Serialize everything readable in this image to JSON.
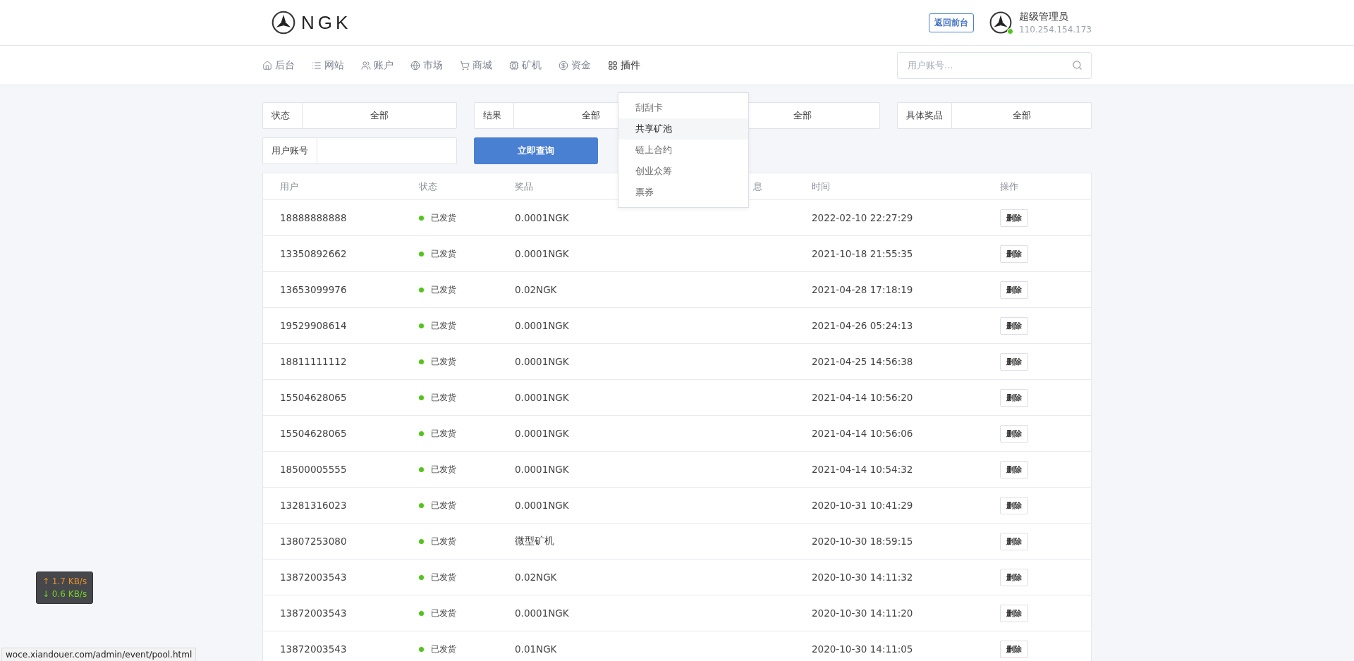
{
  "header": {
    "logo_text": "NGK",
    "back_button": "返回前台",
    "user": {
      "name": "超级管理员",
      "ip": "110.254.154.173",
      "online": true
    }
  },
  "nav": {
    "items": [
      {
        "kind": "home",
        "label": "后台",
        "selected": false
      },
      {
        "kind": "list",
        "label": "网站",
        "selected": false
      },
      {
        "kind": "users",
        "label": "账户",
        "selected": false
      },
      {
        "kind": "globe",
        "label": "市场",
        "selected": false
      },
      {
        "kind": "cart",
        "label": "商城",
        "selected": false
      },
      {
        "kind": "chip",
        "label": "矿机",
        "selected": false
      },
      {
        "kind": "coin",
        "label": "资金",
        "selected": false
      },
      {
        "kind": "grid",
        "label": "插件",
        "selected": true
      }
    ],
    "search": {
      "placeholder": "用户账号..."
    },
    "dropdown": [
      {
        "label": "刮刮卡",
        "selected": false
      },
      {
        "label": "共享矿池",
        "selected": true
      },
      {
        "label": "链上合约",
        "selected": false
      },
      {
        "label": "创业众筹",
        "selected": false
      },
      {
        "label": "票券",
        "selected": false
      }
    ]
  },
  "filters": [
    {
      "label": "状态",
      "value": "全部"
    },
    {
      "label": "结果",
      "value": "全部"
    },
    {
      "value": "全部"
    },
    {
      "label": "具体奖品",
      "value": "全部"
    }
  ],
  "account_filter": {
    "label": "用户账号"
  },
  "query_button": "立即查询",
  "table": {
    "columns": [
      "用户",
      "状态",
      "奖品",
      "息",
      "时间",
      "操作"
    ],
    "rows": [
      {
        "user": "18888888888",
        "status": "已发货",
        "prize": "0.0001NGK",
        "time": "2022-02-10 22:27:29",
        "action": "删除"
      },
      {
        "user": "13350892662",
        "status": "已发货",
        "prize": "0.0001NGK",
        "time": "2021-10-18 21:55:35",
        "action": "删除"
      },
      {
        "user": "13653099976",
        "status": "已发货",
        "prize": "0.02NGK",
        "time": "2021-04-28 17:18:19",
        "action": "删除"
      },
      {
        "user": "19529908614",
        "status": "已发货",
        "prize": "0.0001NGK",
        "time": "2021-04-26 05:24:13",
        "action": "删除"
      },
      {
        "user": "18811111112",
        "status": "已发货",
        "prize": "0.0001NGK",
        "time": "2021-04-25 14:56:38",
        "action": "删除"
      },
      {
        "user": "15504628065",
        "status": "已发货",
        "prize": "0.0001NGK",
        "time": "2021-04-14 10:56:20",
        "action": "删除"
      },
      {
        "user": "15504628065",
        "status": "已发货",
        "prize": "0.0001NGK",
        "time": "2021-04-14 10:56:06",
        "action": "删除"
      },
      {
        "user": "18500005555",
        "status": "已发货",
        "prize": "0.0001NGK",
        "time": "2021-04-14 10:54:32",
        "action": "删除"
      },
      {
        "user": "13281316023",
        "status": "已发货",
        "prize": "0.0001NGK",
        "time": "2020-10-31 10:41:29",
        "action": "删除"
      },
      {
        "user": "13807253080",
        "status": "已发货",
        "prize": "微型矿机",
        "time": "2020-10-30 18:59:15",
        "action": "删除"
      },
      {
        "user": "13872003543",
        "status": "已发货",
        "prize": "0.02NGK",
        "time": "2020-10-30 14:11:32",
        "action": "删除"
      },
      {
        "user": "13872003543",
        "status": "已发货",
        "prize": "0.0001NGK",
        "time": "2020-10-30 14:11:20",
        "action": "删除"
      },
      {
        "user": "13872003543",
        "status": "已发货",
        "prize": "0.01NGK",
        "time": "2020-10-30 14:11:05",
        "action": "删除"
      }
    ]
  },
  "net_widget": {
    "up": "↑ 1.7 KB/s",
    "down": "↓ 0.6 KB/s"
  },
  "status_url": "woce.xiandouer.com/admin/event/pool.html"
}
